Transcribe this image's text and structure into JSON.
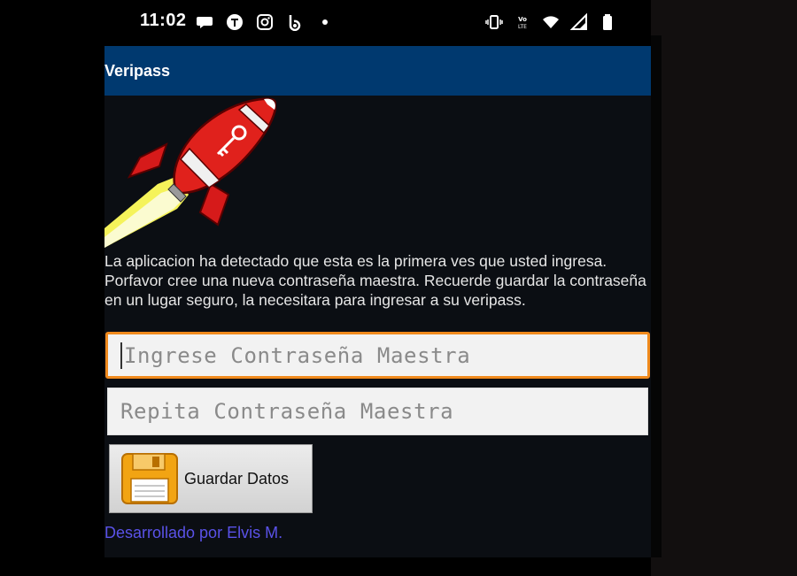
{
  "status_bar": {
    "time": "11:02",
    "left_icons": [
      "chat-bubble-icon",
      "tiktok-icon",
      "instagram-icon",
      "bing-icon",
      "dot-icon"
    ],
    "right_icons": [
      "vibrate-icon",
      "volte-icon",
      "wifi-icon",
      "signal-icon",
      "battery-icon"
    ],
    "volte_text": "Vo LTE"
  },
  "app_bar": {
    "title": "Veripass",
    "color": "#00396f"
  },
  "content": {
    "illustration": "rocket-with-key-icon",
    "message": "La aplicacion ha detectado que esta es la primera ves que usted ingresa. Porfavor cree una nueva contraseña maestra. Recuerde guardar la contraseña en un lugar seguro, la necesitara para ingresar a su veripass.",
    "master_password": {
      "value": "",
      "placeholder": "Ingrese Contraseña Maestra",
      "focus_color": "#f08a1d"
    },
    "repeat_password": {
      "value": "",
      "placeholder": "Repita Contraseña Maestra"
    },
    "save_button": {
      "label": "Guardar Datos",
      "icon": "floppy-disk-icon"
    },
    "footer_text": "Desarrollado por Elvis M.",
    "footer_color": "#5a52e8"
  }
}
